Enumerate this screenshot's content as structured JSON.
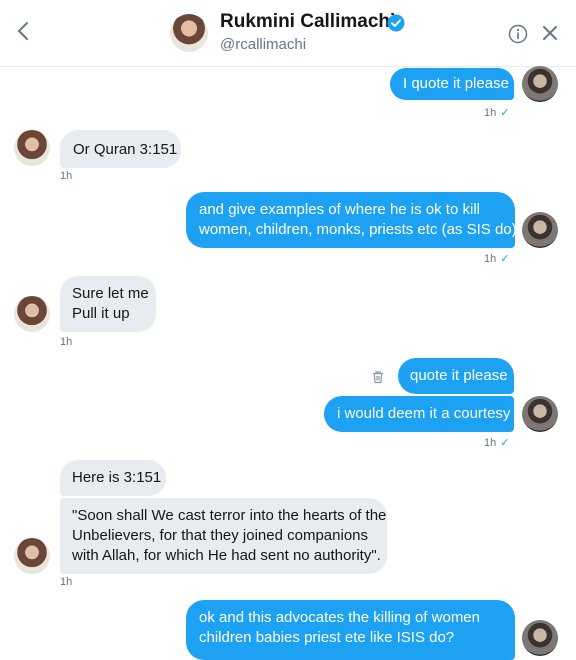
{
  "header": {
    "name": "Rukmini Callimachi",
    "handle": "@rcallimachi"
  },
  "messages": [
    {
      "text": "I quote it please",
      "time": "1h",
      "check": "✓"
    },
    {
      "text": "Or Quran 3:151",
      "time": "1h"
    },
    {
      "line1": "and give examples of where he is ok to kill",
      "line2": "women, children, monks, priests etc (as SIS do)",
      "time": "1h",
      "check": "✓"
    },
    {
      "line1": "Sure let me",
      "line2": "Pull it up",
      "time": "1h"
    },
    {
      "text": "quote it please"
    },
    {
      "text": "i would deem it a courtesy",
      "time": "1h",
      "check": "✓"
    },
    {
      "text": "Here is 3:151"
    },
    {
      "line1": "\"Soon shall We cast terror into the hearts of the",
      "line2": "Unbelievers, for that they joined companions",
      "line3": "with Allah, for which He had sent no authority\".",
      "time": "1h"
    },
    {
      "line1": "ok and this advocates the killing of women",
      "line2": "children babies priest ete like ISIS do?"
    }
  ]
}
